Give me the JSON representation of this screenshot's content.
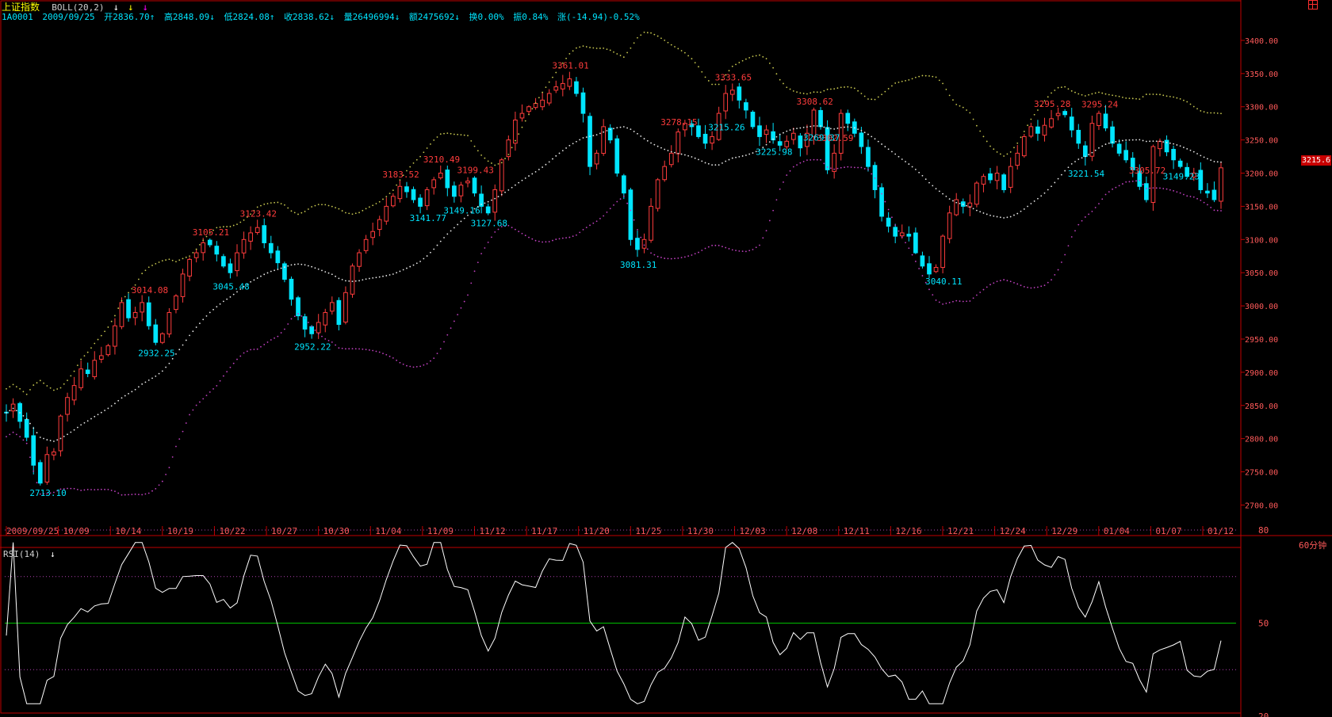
{
  "header": {
    "name": "上证指数",
    "indicator": "BOLL(20,2)",
    "arrows": [
      "↓",
      "↓",
      "↓"
    ],
    "arrow_colors": [
      "#ffffff",
      "#ffff00",
      "#ff00ff"
    ],
    "code": "1A0001",
    "date": "2009/09/25",
    "open": "开2836.70↑",
    "high": "高2848.09↓",
    "low": "低2824.08↑",
    "close": "收2838.62↓",
    "volume": "量26496994↓",
    "amount": "额2475692↓",
    "turnover": "换0.00%",
    "amplitude": "振0.84%",
    "change": "涨(-14.94)-0.52%"
  },
  "current_price_tag": "3215.6",
  "period_label": "60分钟",
  "rsi_title": "RSI(14)",
  "rsi_arrow": "↓",
  "colors": {
    "up": "#ff3c3c",
    "down": "#00e5ff",
    "boll_upper": "#c8c850",
    "boll_mid": "#e8e8e8",
    "boll_lower": "#c040c0",
    "rsi_line": "#ffffff",
    "rsi_mid": "#00c000",
    "frame": "#c00000",
    "grid_label": "#ff5a5a"
  },
  "chart_data": [
    {
      "type": "candlestick",
      "title": "上证指数 60分钟 BOLL(20,2)",
      "ylim": [
        2685,
        3425
      ],
      "y_ticks": [
        2700,
        2750,
        2800,
        2850,
        2900,
        2950,
        3000,
        3050,
        3100,
        3150,
        3200,
        3250,
        3300,
        3350,
        3400
      ],
      "y_tick_labels": [
        "2700.00",
        "2750.00",
        "2800.00",
        "2850.00",
        "2900.00",
        "2950.00",
        "3000.00",
        "3050.00",
        "3100.00",
        "3150.00",
        "3200.00",
        "3250.00",
        "3300.00",
        "3350.00",
        "3400.00"
      ],
      "x_tick_labels": [
        "2009/09/25",
        "10/09",
        "10/14",
        "10/19",
        "10/22",
        "10/27",
        "10/30",
        "11/04",
        "11/09",
        "11/12",
        "11/17",
        "11/20",
        "11/25",
        "11/30",
        "12/03",
        "12/08",
        "12/11",
        "12/16",
        "12/21",
        "12/24",
        "12/29",
        "01/04",
        "01/07",
        "01/12"
      ],
      "closes": [
        2839,
        2852,
        2826,
        2802,
        2760,
        2733,
        2776,
        2780,
        2834,
        2862,
        2880,
        2905,
        2898,
        2918,
        2925,
        2940,
        2970,
        3005,
        2982,
        2990,
        3005,
        2970,
        2945,
        2958,
        2990,
        3015,
        3048,
        3070,
        3080,
        3095,
        3092,
        3078,
        3060,
        3050,
        3080,
        3100,
        3110,
        3118,
        3095,
        3080,
        3065,
        3040,
        3010,
        2985,
        2965,
        2958,
        2975,
        2990,
        3005,
        2972,
        3020,
        3060,
        3080,
        3100,
        3112,
        3130,
        3150,
        3165,
        3180,
        3172,
        3160,
        3150,
        3175,
        3190,
        3200,
        3178,
        3165,
        3182,
        3188,
        3170,
        3150,
        3140,
        3175,
        3220,
        3250,
        3280,
        3290,
        3300,
        3305,
        3310,
        3320,
        3330,
        3335,
        3342,
        3320,
        3290,
        3210,
        3230,
        3270,
        3250,
        3200,
        3170,
        3100,
        3085,
        3100,
        3150,
        3190,
        3210,
        3230,
        3262,
        3275,
        3270,
        3255,
        3245,
        3255,
        3290,
        3320,
        3325,
        3310,
        3295,
        3270,
        3255,
        3265,
        3250,
        3242,
        3248,
        3260,
        3238,
        3260,
        3295,
        3270,
        3205,
        3230,
        3290,
        3275,
        3260,
        3240,
        3210,
        3175,
        3135,
        3120,
        3105,
        3110,
        3105,
        3080,
        3060,
        3048,
        3058,
        3105,
        3140,
        3160,
        3150,
        3155,
        3185,
        3195,
        3190,
        3200,
        3175,
        3210,
        3230,
        3255,
        3270,
        3260,
        3272,
        3282,
        3290,
        3288,
        3265,
        3245,
        3225,
        3275,
        3290,
        3268,
        3245,
        3230,
        3220,
        3205,
        3180,
        3160,
        3240,
        3248,
        3232,
        3220,
        3210,
        3195,
        3200,
        3175,
        3170,
        3160,
        3208
      ],
      "annotations_high": [
        {
          "label": "3014.08",
          "index": 21
        },
        {
          "label": "3105.21",
          "index": 30
        },
        {
          "label": "3123.42",
          "index": 37
        },
        {
          "label": "3183.52",
          "index": 58
        },
        {
          "label": "3210.49",
          "index": 64
        },
        {
          "label": "3199.43",
          "index": 69
        },
        {
          "label": "3361.01",
          "index": 83
        },
        {
          "label": "3278.15",
          "index": 99
        },
        {
          "label": "3333.65",
          "index": 107
        },
        {
          "label": "3308.62",
          "index": 119
        },
        {
          "label": "3302.59",
          "index": 122
        },
        {
          "label": "3295.28",
          "index": 154
        },
        {
          "label": "3295.24",
          "index": 161
        },
        {
          "label": "3305.72",
          "index": 168
        }
      ],
      "annotations_low": [
        {
          "label": "2713.10",
          "index": 6
        },
        {
          "label": "2932.25",
          "index": 22
        },
        {
          "label": "3045.48",
          "index": 33
        },
        {
          "label": "2952.22",
          "index": 45
        },
        {
          "label": "3141.77",
          "index": 62
        },
        {
          "label": "3149.16",
          "index": 67
        },
        {
          "label": "3127.68",
          "index": 71
        },
        {
          "label": "3081.31",
          "index": 93
        },
        {
          "label": "3215.26",
          "index": 106
        },
        {
          "label": "3225.98",
          "index": 113
        },
        {
          "label": "3269.37",
          "index": 120
        },
        {
          "label": "3040.11",
          "index": 138
        },
        {
          "label": "3221.54",
          "index": 159
        },
        {
          "label": "3149.23",
          "index": 173
        }
      ]
    },
    {
      "type": "line",
      "title": "RSI(14)",
      "ylim": [
        20,
        80
      ],
      "y_ticks": [
        20,
        50,
        80
      ],
      "y_tick_labels": [
        "20",
        "50",
        "80"
      ],
      "dotted_levels": [
        35,
        50,
        65,
        80
      ]
    }
  ]
}
